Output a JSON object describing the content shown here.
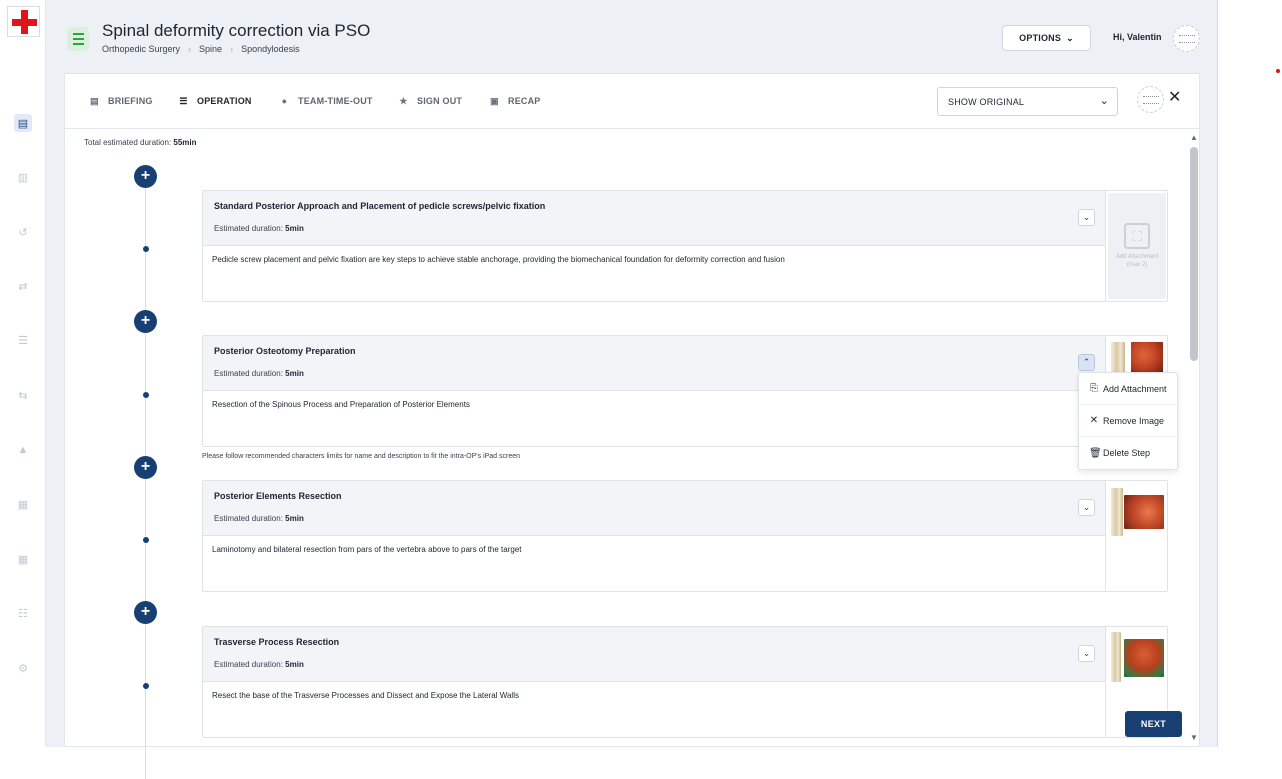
{
  "header": {
    "title": "Spinal deformity correction via PSO",
    "breadcrumb": [
      "Orthopedic Surgery",
      "Spine",
      "Spondylodesis"
    ],
    "options_label": "OPTIONS",
    "greeting": "Hi, Valentin"
  },
  "left_rail": {
    "icons": [
      "dashboard-icon",
      "library-icon",
      "history-icon",
      "shuffle-icon",
      "checklist-icon",
      "shuffle-alt-icon",
      "warning-icon",
      "chart-icon",
      "table-icon",
      "search-list-icon",
      "settings-icon"
    ]
  },
  "tabs": [
    {
      "label": "BRIEFING",
      "icon": "document-icon",
      "active": false
    },
    {
      "label": "OPERATION",
      "icon": "list-icon",
      "active": true
    },
    {
      "label": "TEAM-TIME-OUT",
      "icon": "help-circle-icon",
      "active": false
    },
    {
      "label": "SIGN OUT",
      "icon": "star-icon",
      "active": false
    },
    {
      "label": "RECAP",
      "icon": "summary-icon",
      "active": false
    }
  ],
  "show_original": {
    "value": "SHOW ORIGINAL"
  },
  "total": {
    "label": "Total estimated duration:",
    "value": "55min"
  },
  "duration_label": "Estimated duration:",
  "steps": [
    {
      "title": "Standard Posterior Approach and Placement of pedicle screws/pelvic fixation",
      "duration": "5min",
      "description": "Pedicle screw placement and pelvic fixation are key steps to achieve stable anchorage, providing the biomechanical foundation for deformity correction and fusion",
      "expanded": false
    },
    {
      "title": "Posterior Osteotomy Preparation",
      "duration": "5min",
      "description": "Resection of the Spinous Process and Preparation of Posterior Elements",
      "expanded": true
    },
    {
      "title": "Posterior Elements Resection",
      "duration": "5min",
      "description": "Laminotomy and bilateral resection from pars of the vertebra above to pars of the target",
      "expanded": false
    },
    {
      "title": "Trasverse Process Resection",
      "duration": "5min",
      "description": "Resect the base of the Trasverse Processes and Dissect and Expose the Lateral Walls",
      "expanded": false
    }
  ],
  "add_attachment_box": {
    "label": "Add Attachment",
    "sublabel": "(max 2)"
  },
  "hint": "Please follow recommended characters limits for name and description to fit the intra-OP's iPad screen",
  "context_menu": {
    "items": [
      {
        "label": "Add Attachment",
        "icon": "paperclip-icon"
      },
      {
        "label": "Remove Image",
        "icon": "close-icon"
      },
      {
        "label": "Delete Step",
        "icon": "trash-icon"
      }
    ]
  },
  "next_label": "NEXT",
  "colors": {
    "brand_red": "#e0151b",
    "primary": "#173f73",
    "menu_green": "#2ea043"
  }
}
